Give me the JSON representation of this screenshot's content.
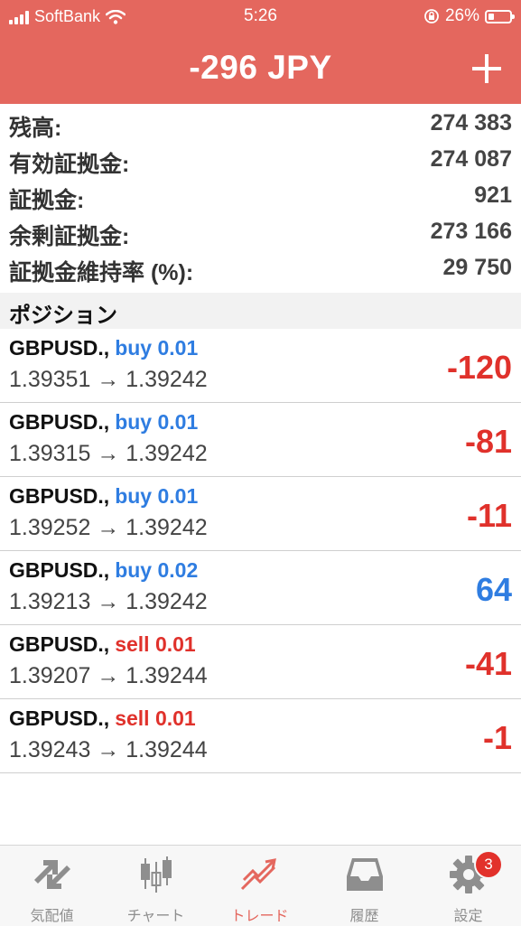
{
  "status_bar": {
    "carrier": "SoftBank",
    "time": "5:26",
    "battery": "26%",
    "battery_level": 0.26
  },
  "header": {
    "title": "-296 JPY",
    "add_icon": "plus-icon"
  },
  "summary": [
    {
      "label": "残高:",
      "value": "274 383"
    },
    {
      "label": "有効証拠金:",
      "value": "274 087"
    },
    {
      "label": "証拠金:",
      "value": "921"
    },
    {
      "label": "余剰証拠金:",
      "value": "273 166"
    },
    {
      "label": "証拠金維持率 (%):",
      "value": "29 750"
    }
  ],
  "positions_header": "ポジション",
  "positions": [
    {
      "symbol": "GBPUSD.,",
      "side": "buy 0.01",
      "prices": "1.39351 → 1.39242",
      "profit": "-120"
    },
    {
      "symbol": "GBPUSD.,",
      "side": "buy 0.01",
      "prices": "1.39315 → 1.39242",
      "profit": "-81"
    },
    {
      "symbol": "GBPUSD.,",
      "side": "buy 0.01",
      "prices": "1.39252 → 1.39242",
      "profit": "-11"
    },
    {
      "symbol": "GBPUSD.,",
      "side": "buy 0.02",
      "prices": "1.39213 → 1.39242",
      "profit": "64"
    },
    {
      "symbol": "GBPUSD.,",
      "side": "sell 0.01",
      "prices": "1.39207 → 1.39244",
      "profit": "-41"
    },
    {
      "symbol": "GBPUSD.,",
      "side": "sell 0.01",
      "prices": "1.39243 → 1.39244",
      "profit": "-1"
    }
  ],
  "tabs": [
    {
      "label": "気配値",
      "icon": "quotes-icon"
    },
    {
      "label": "チャート",
      "icon": "candlestick-chart-icon"
    },
    {
      "label": "トレード",
      "icon": "trade-icon",
      "active": true
    },
    {
      "label": "履歴",
      "icon": "history-tray-icon"
    },
    {
      "label": "設定",
      "icon": "gear-icon",
      "badge": "3"
    }
  ],
  "colors": {
    "header": "#e4675e",
    "buy": "#2f7de1",
    "sell": "#e0312b",
    "profit_positive": "#2f7de1",
    "profit_negative": "#e0312b",
    "badge": "#e2312b"
  }
}
